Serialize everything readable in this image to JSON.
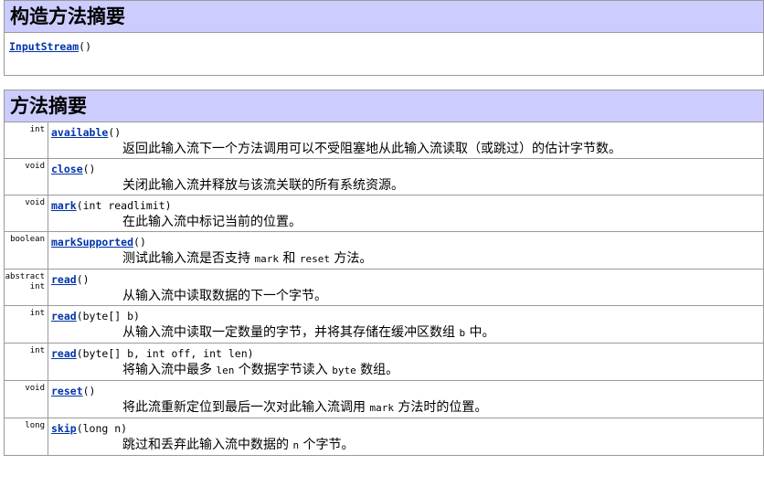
{
  "constructor_summary": {
    "title": "构造方法摘要",
    "entries": [
      {
        "name": "InputStream",
        "params": "()"
      }
    ]
  },
  "method_summary": {
    "title": "方法摘要",
    "methods": [
      {
        "type": "int",
        "name": "available",
        "params": "()",
        "desc": [
          {
            "text": "返回此输入流下一个方法调用可以不受阻塞地从此输入流读取（或跳过）的估计字节数。"
          }
        ]
      },
      {
        "type": "void",
        "name": "close",
        "params": "()",
        "desc": [
          {
            "text": "关闭此输入流并释放与该流关联的所有系统资源。"
          }
        ]
      },
      {
        "type": "void",
        "name": "mark",
        "params": "(int readlimit)",
        "desc": [
          {
            "text": "在此输入流中标记当前的位置。"
          }
        ]
      },
      {
        "type": "boolean",
        "name": "markSupported",
        "params": "()",
        "desc": [
          {
            "text": "测试此输入流是否支持 "
          },
          {
            "code": "mark"
          },
          {
            "text": " 和 "
          },
          {
            "code": "reset"
          },
          {
            "text": " 方法。"
          }
        ]
      },
      {
        "type": "abstract int",
        "type_lines": [
          "abstract",
          "int"
        ],
        "name": "read",
        "params": "()",
        "desc": [
          {
            "text": "从输入流中读取数据的下一个字节。"
          }
        ]
      },
      {
        "type": "int",
        "name": "read",
        "params": "(byte[] b)",
        "desc": [
          {
            "text": "从输入流中读取一定数量的字节，并将其存储在缓冲区数组 "
          },
          {
            "code": "b"
          },
          {
            "text": " 中。"
          }
        ]
      },
      {
        "type": "int",
        "name": "read",
        "params": "(byte[] b, int off, int len)",
        "desc": [
          {
            "text": "将输入流中最多 "
          },
          {
            "code": "len"
          },
          {
            "text": " 个数据字节读入 "
          },
          {
            "code": "byte"
          },
          {
            "text": " 数组。"
          }
        ]
      },
      {
        "type": "void",
        "name": "reset",
        "params": "()",
        "desc": [
          {
            "text": "将此流重新定位到最后一次对此输入流调用 "
          },
          {
            "code": "mark"
          },
          {
            "text": " 方法时的位置。"
          }
        ]
      },
      {
        "type": "long",
        "name": "skip",
        "params": "(long n)",
        "desc": [
          {
            "text": "跳过和丢弃此输入流中数据的 "
          },
          {
            "code": "n"
          },
          {
            "text": " 个字节。"
          }
        ]
      }
    ]
  }
}
